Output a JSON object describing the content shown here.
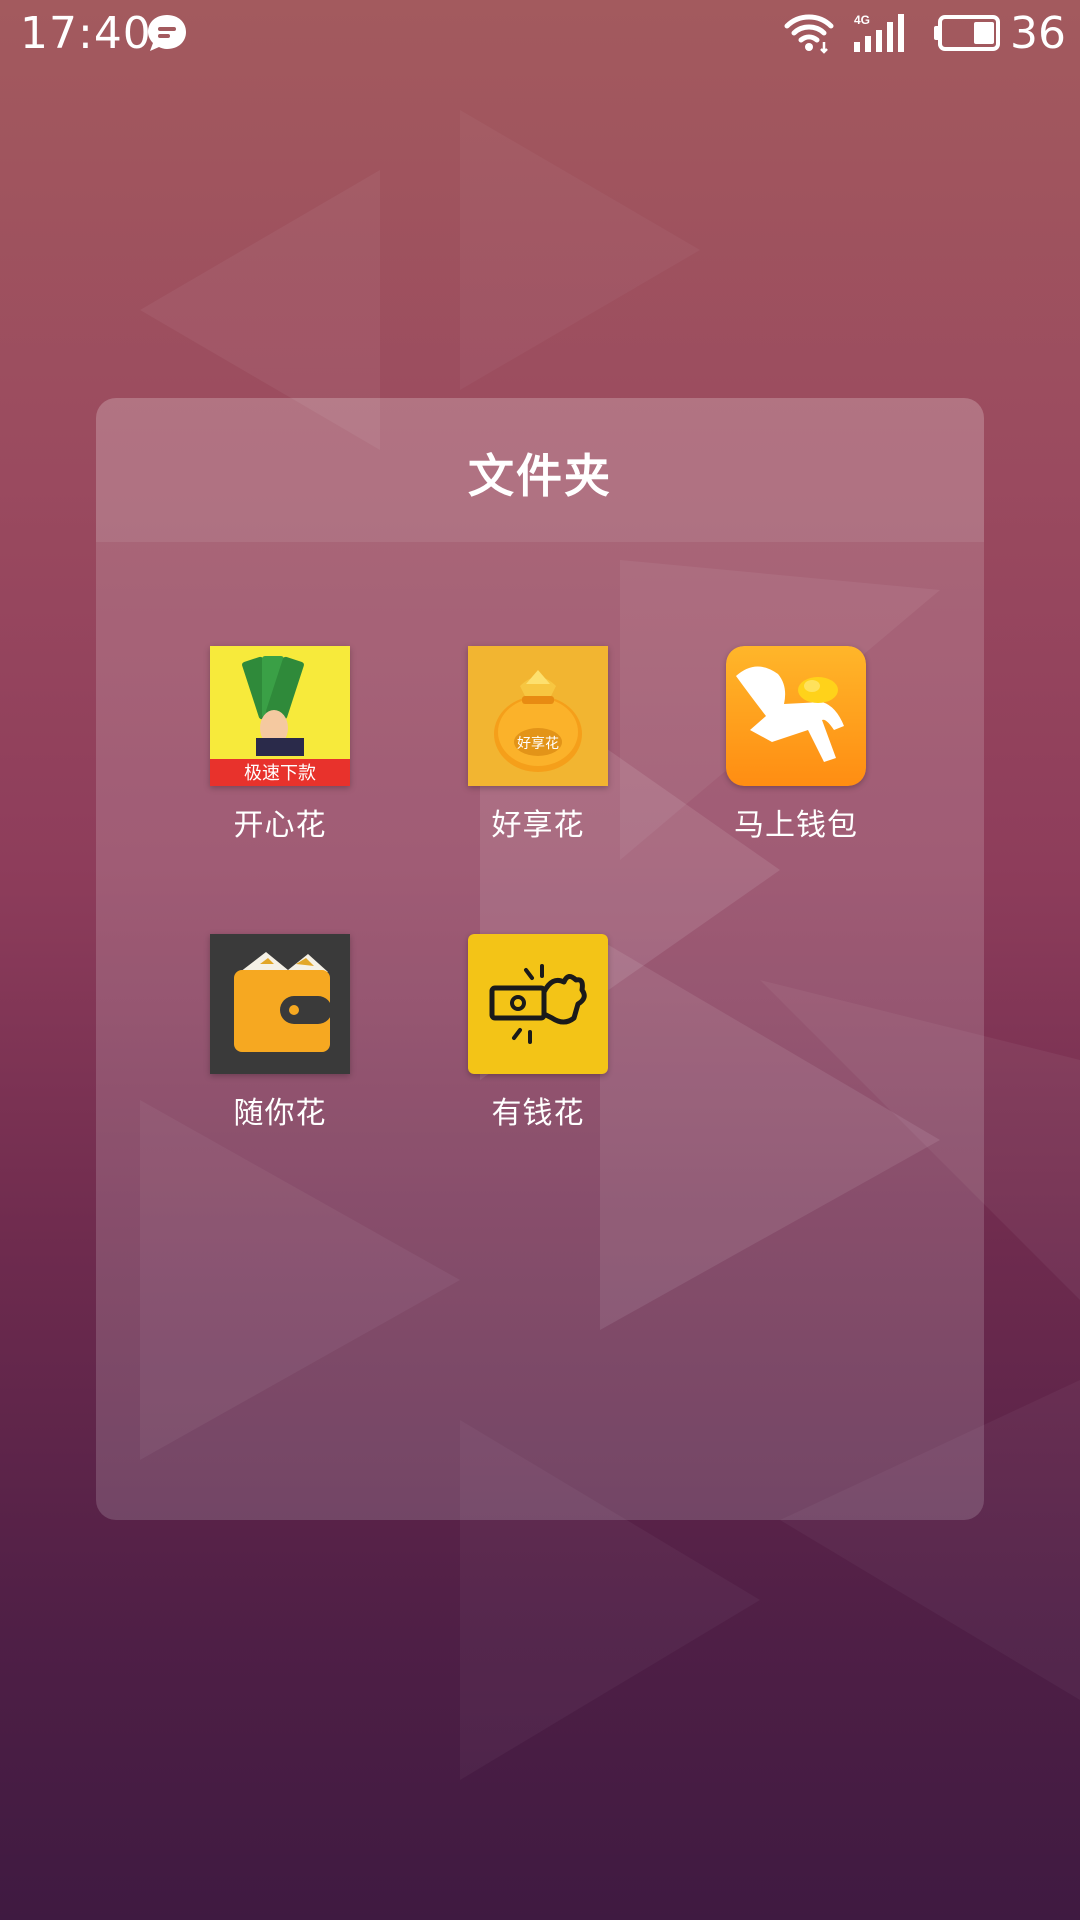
{
  "status_bar": {
    "time": "17:40",
    "network": "4G",
    "battery_level": "36",
    "icons": [
      "message-icon",
      "wifi-icon",
      "signal-icon",
      "battery-icon"
    ]
  },
  "folder": {
    "title": "文件夹",
    "apps": [
      {
        "label": "开心花",
        "icon_text": "极速下款",
        "icon": "money-hand-icon",
        "color": "#f7ea3b"
      },
      {
        "label": "好享花",
        "icon_text": "好享花",
        "icon": "money-bag-icon",
        "color": "#f2b531"
      },
      {
        "label": "马上钱包",
        "icon": "running-horse-icon",
        "color": "#ff9f1c"
      },
      {
        "label": "随你花",
        "icon": "wallet-icon",
        "color": "#3a3a3a"
      },
      {
        "label": "有钱花",
        "icon": "cash-hand-icon",
        "color": "#f3c417"
      }
    ]
  }
}
